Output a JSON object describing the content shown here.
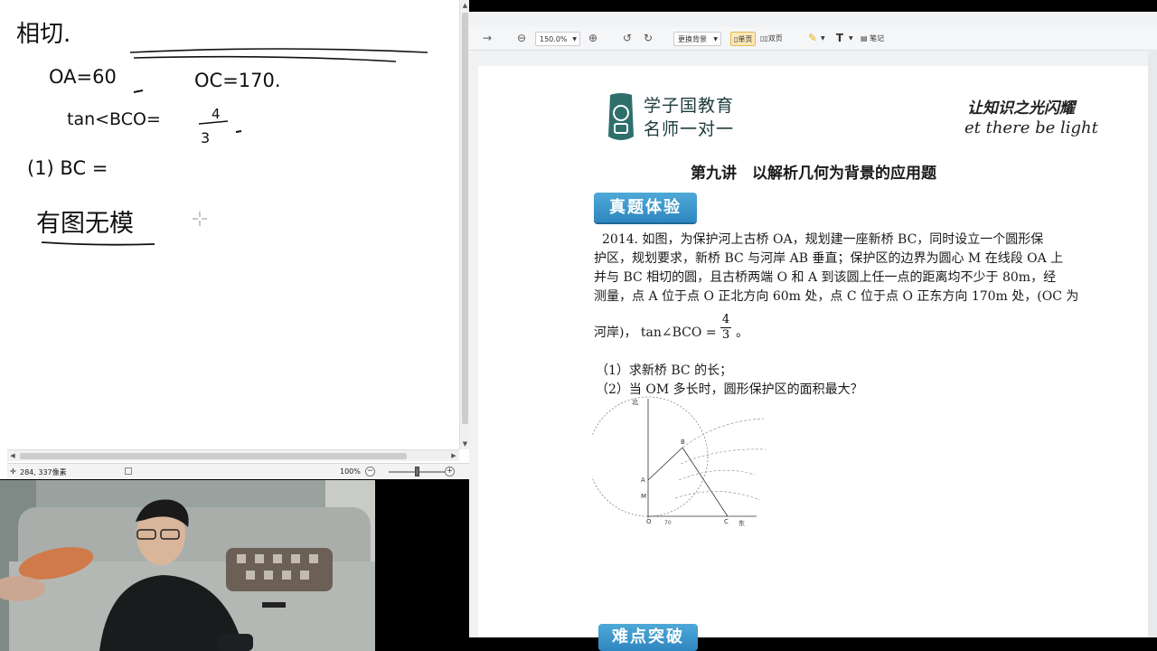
{
  "paint": {
    "canvas_text": {
      "line1": "相切.",
      "line2_a": "OA=60",
      "line2_b": "OC=170.",
      "line3_a": "tan<BCO=",
      "line3_num": "4",
      "line3_den": "3",
      "line4": "(1) BC =",
      "line5": "有图无模"
    },
    "status": {
      "coords": "284, 337像素",
      "zoom": "100%",
      "zoom_minus": "−",
      "zoom_plus": "+"
    }
  },
  "reader": {
    "toolbar": {
      "zoom_value": "150.0%",
      "background_label": "更换背景",
      "single_page": "单页",
      "double_page": "双页",
      "notes": "笔记"
    },
    "document": {
      "logo_line1": "学子国教育",
      "logo_line2": "名师一对一",
      "slogan_cn": "让知识之光闪耀",
      "slogan_en": "et there be light",
      "lecture_title": "第九讲　以解析几何为背景的应用题",
      "section_badge": "真题体验",
      "section_badge_2": "难点突破",
      "problem_lines": [
        "2014. 如图，为保护河上古桥 OA，规划建一座新桥 BC，同时设立一个圆形保",
        "护区，规划要求，新桥 BC 与河岸 AB 垂直；保护区的边界为圆心 M 在线段 OA 上",
        "并与 BC 相切的圆，且古桥两端 O 和 A 到该圆上任一点的距离均不少于 80m，经",
        "测量，点 A 位于点 O 正北方向 60m 处，点 C 位于点 O 正东方向 170m 处，(OC 为",
        "河岸)，  tan∠BCO = ",
        "。"
      ],
      "tan_num": "4",
      "tan_den": "3",
      "question1": "（1）求新桥 BC 的长；",
      "question2": "（2）当 OM 多长时，圆形保护区的面积最大？",
      "diagram_labels": {
        "north": "北",
        "east": "东",
        "o": "O",
        "a": "A",
        "m": "M",
        "b": "B",
        "c": "C",
        "scale": "70"
      }
    }
  },
  "colors": {
    "badge_blue": "#3a96cc",
    "toolbar_bg": "#f5f6f8",
    "active_tab": "#fce8b8"
  }
}
